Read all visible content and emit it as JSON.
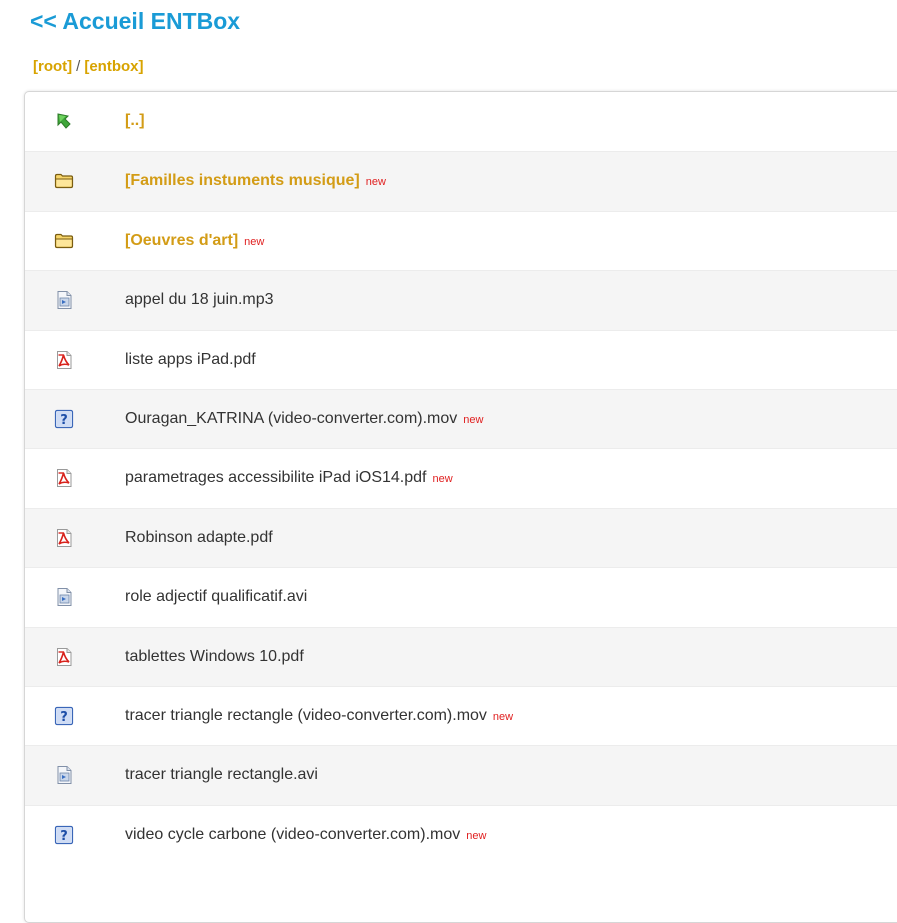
{
  "header": {
    "home_link": "<< Accueil ENTBox",
    "breadcrumb": {
      "root": "[root]",
      "separator": "/",
      "current": "[entbox]"
    }
  },
  "colors": {
    "link_blue": "#1a9bd6",
    "folder_text": "#d39c16",
    "new_badge": "#e02020",
    "row_alt": "#f5f5f5"
  },
  "rows": [
    {
      "label": "[..]",
      "type": "parent",
      "icon": "parent-directory-icon",
      "badge": ""
    },
    {
      "label": "[Familles instuments musique]",
      "type": "folder",
      "icon": "folder-icon",
      "badge": "new"
    },
    {
      "label": "[Oeuvres d'art]",
      "type": "folder",
      "icon": "folder-icon",
      "badge": "new"
    },
    {
      "label": "appel du 18 juin.mp3",
      "type": "media",
      "icon": "media-file-icon",
      "badge": ""
    },
    {
      "label": "liste apps iPad.pdf",
      "type": "pdf",
      "icon": "pdf-file-icon",
      "badge": ""
    },
    {
      "label": "Ouragan_KATRINA (video-converter.com).mov",
      "type": "unknown",
      "icon": "unknown-file-icon",
      "badge": "new"
    },
    {
      "label": "parametrages accessibilite iPad iOS14.pdf",
      "type": "pdf",
      "icon": "pdf-file-icon",
      "badge": "new"
    },
    {
      "label": "Robinson adapte.pdf",
      "type": "pdf",
      "icon": "pdf-file-icon",
      "badge": ""
    },
    {
      "label": "role adjectif qualificatif.avi",
      "type": "media",
      "icon": "media-file-icon",
      "badge": ""
    },
    {
      "label": "tablettes Windows 10.pdf",
      "type": "pdf",
      "icon": "pdf-file-icon",
      "badge": ""
    },
    {
      "label": "tracer triangle rectangle (video-converter.com).mov",
      "type": "unknown",
      "icon": "unknown-file-icon",
      "badge": "new"
    },
    {
      "label": "tracer triangle rectangle.avi",
      "type": "media",
      "icon": "media-file-icon",
      "badge": ""
    },
    {
      "label": "video cycle carbone (video-converter.com).mov",
      "type": "unknown",
      "icon": "unknown-file-icon",
      "badge": "new"
    }
  ]
}
